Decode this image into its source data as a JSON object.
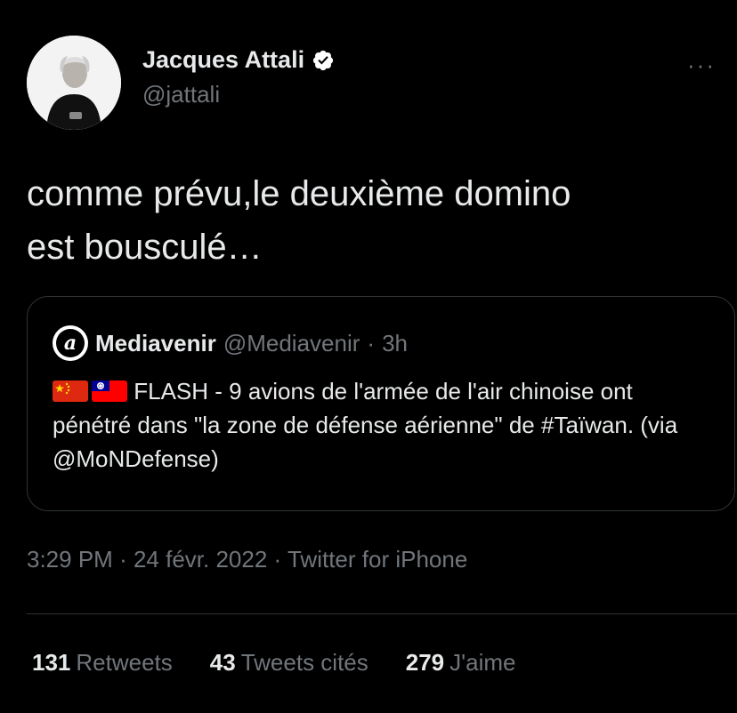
{
  "author": {
    "name": "Jacques Attali",
    "handle": "@jattali",
    "verified_icon": "verified-badge-icon"
  },
  "more_label": "···",
  "tweet": {
    "line1": "comme prévu,le deuxième domino",
    "line2": "est bousculé…"
  },
  "quote": {
    "logo_letter": "a",
    "name": "Mediavenir",
    "handle": "@Mediavenir",
    "separator": "·",
    "time": "3h",
    "flags": [
      "china-flag-icon",
      "taiwan-flag-icon"
    ],
    "text": "FLASH - 9 avions de l'armée de l'air chinoise ont pénétré dans \"la zone de défense aérienne\" de #Taïwan. (via @MoNDefense)"
  },
  "timestamp": {
    "time": "3:29 PM",
    "separator": "·",
    "date": "24 févr. 2022",
    "source": "Twitter for iPhone"
  },
  "stats": [
    {
      "count": "131",
      "label": "Retweets"
    },
    {
      "count": "43",
      "label": "Tweets cités"
    },
    {
      "count": "279",
      "label": "J'aime"
    }
  ],
  "colors": {
    "background": "#000000",
    "text": "#e7e9ea",
    "secondary": "#71767b",
    "border": "#2f3336",
    "verified": "#ffffff"
  }
}
